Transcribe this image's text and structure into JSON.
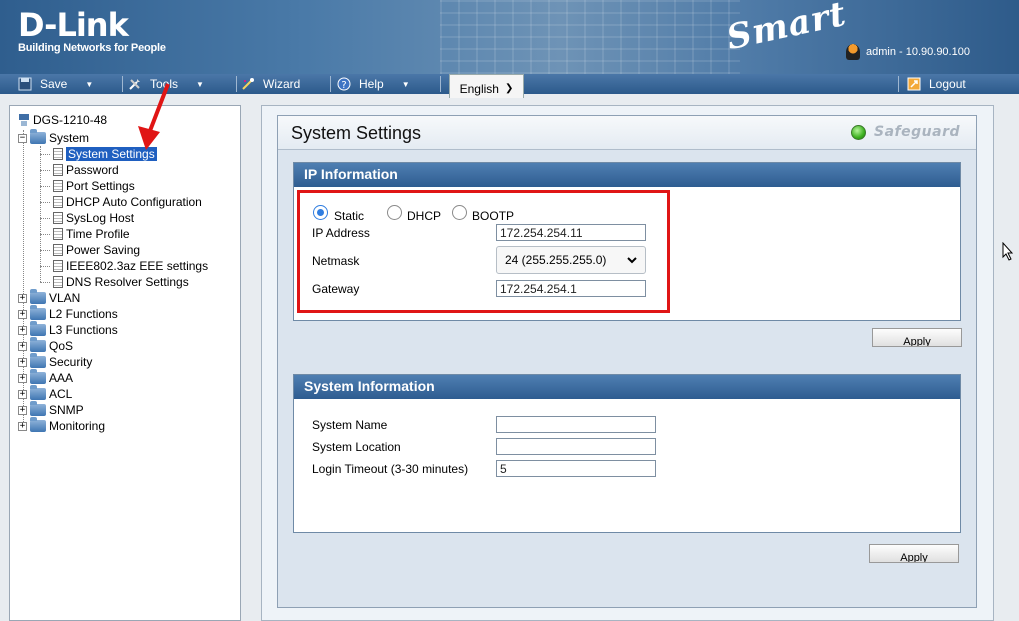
{
  "header": {
    "brand": "D-Link",
    "tagline": "Building Networks for People",
    "product": "Smart",
    "user_info": "admin - 10.90.90.100"
  },
  "toolbar": {
    "save": "Save",
    "tools": "Tools",
    "wizard": "Wizard",
    "help": "Help",
    "language": "English",
    "logout": "Logout"
  },
  "tree": {
    "root": "DGS-1210-48",
    "system": "System",
    "system_items": [
      "System Settings",
      "Password",
      "Port Settings",
      "DHCP Auto Configuration",
      "SysLog Host",
      "Time Profile",
      "Power Saving",
      "IEEE802.3az EEE settings",
      "DNS Resolver Settings"
    ],
    "folders": [
      "VLAN",
      "L2 Functions",
      "L3 Functions",
      "QoS",
      "Security",
      "AAA",
      "ACL",
      "SNMP",
      "Monitoring"
    ]
  },
  "page": {
    "title": "System Settings",
    "safeguard": "Safeguard"
  },
  "ip_info": {
    "heading": "IP Information",
    "mode_static": "Static",
    "mode_dhcp": "DHCP",
    "mode_bootp": "BOOTP",
    "ip_label": "IP Address",
    "ip_value": "172.254.254.11",
    "netmask_label": "Netmask",
    "netmask_value": "24 (255.255.255.0)",
    "gateway_label": "Gateway",
    "gateway_value": "172.254.254.1",
    "apply": "Apply"
  },
  "sys_info": {
    "heading": "System Information",
    "name_label": "System Name",
    "name_value": "",
    "location_label": "System Location",
    "location_value": "",
    "timeout_label": "Login Timeout (3-30 minutes)",
    "timeout_value": "5",
    "apply": "Apply"
  }
}
